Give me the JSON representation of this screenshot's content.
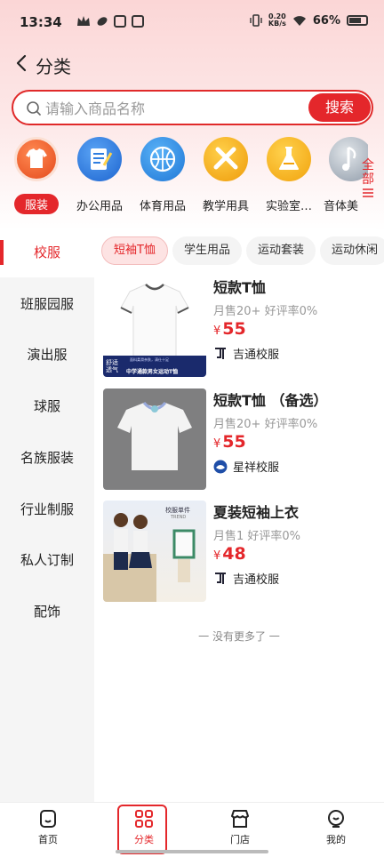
{
  "status_bar": {
    "time": "13:34",
    "net_speed_value": "0.20",
    "net_speed_unit": "KB/s",
    "battery": "66%"
  },
  "header": {
    "title": "分类"
  },
  "search": {
    "placeholder": "请输入商品名称",
    "button": "搜索"
  },
  "categories": [
    {
      "label": "服装",
      "icon": "tshirt-icon",
      "color": "#f05a2a",
      "active": true
    },
    {
      "label": "办公用品",
      "icon": "notepad-icon",
      "color": "#2f7ee0",
      "active": false
    },
    {
      "label": "体育用品",
      "icon": "basketball-icon",
      "color": "#2f8ee5",
      "active": false
    },
    {
      "label": "教学用具",
      "icon": "ruler-pencil-icon",
      "color": "#f2b316",
      "active": false
    },
    {
      "label": "实验室…",
      "icon": "flask-icon",
      "color": "#f4ba18",
      "active": false
    },
    {
      "label": "音体美",
      "icon": "music-note-icon",
      "color": "#9aa6b3",
      "active": false
    }
  ],
  "more_categories": "全部",
  "sidebar": {
    "items": [
      {
        "label": "校服",
        "active": true
      },
      {
        "label": "班服园服"
      },
      {
        "label": "演出服"
      },
      {
        "label": "球服"
      },
      {
        "label": "名族服装"
      },
      {
        "label": "行业制服"
      },
      {
        "label": "私人订制"
      },
      {
        "label": "配饰"
      }
    ]
  },
  "subtabs": [
    {
      "label": "短袖T恤",
      "active": true
    },
    {
      "label": "学生用品"
    },
    {
      "label": "运动套装"
    },
    {
      "label": "运动休闲"
    }
  ],
  "products": [
    {
      "name": "短款T恤",
      "stats": "月售20+  好评率0%",
      "currency": "¥",
      "price": "55",
      "shop": "吉通校服",
      "thumb_badge_1": "舒适",
      "thumb_badge_2": "透气",
      "thumb_caption_small": "面料柔滑亲肤，清仕十足",
      "thumb_caption": "中学通款男女运动T恤"
    },
    {
      "name": "短款T恤 （备选）",
      "stats": "月售20+  好评率0%",
      "currency": "¥",
      "price": "55",
      "shop": "星祥校服"
    },
    {
      "name": "夏装短袖上衣",
      "stats": "月售1  好评率0%",
      "currency": "¥",
      "price": "48",
      "shop": "吉通校服",
      "thumb_title": "校服单件",
      "thumb_subtitle": "TREND"
    }
  ],
  "footer_note": "一 没有更多了 一",
  "bottom_nav": [
    {
      "label": "首页",
      "icon": "home-icon"
    },
    {
      "label": "分类",
      "icon": "grid-icon",
      "active": true
    },
    {
      "label": "门店",
      "icon": "store-icon"
    },
    {
      "label": "我的",
      "icon": "profile-icon"
    }
  ],
  "colors": {
    "accent": "#e4272b",
    "header_bg": "#fbd6d6"
  }
}
